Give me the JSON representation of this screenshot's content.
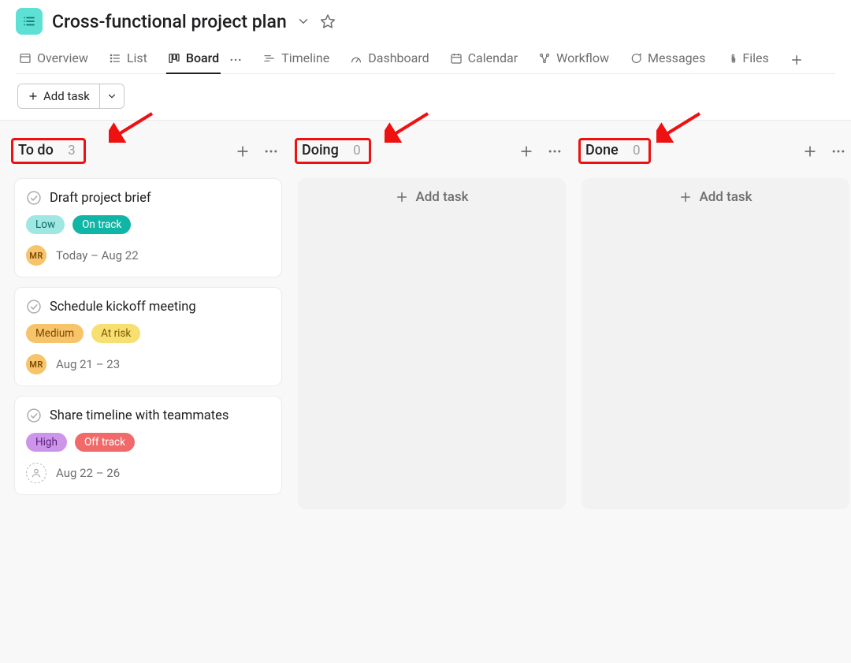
{
  "project": {
    "title": "Cross-functional project plan"
  },
  "tabs": {
    "overview": "Overview",
    "list": "List",
    "board": "Board",
    "timeline": "Timeline",
    "dashboard": "Dashboard",
    "calendar": "Calendar",
    "workflow": "Workflow",
    "messages": "Messages",
    "files": "Files"
  },
  "toolbar": {
    "add_task": "Add task"
  },
  "columns": [
    {
      "title": "To do",
      "count": "3",
      "add_label": "",
      "cards": [
        {
          "title": "Draft project brief",
          "tags": [
            {
              "label": "Low",
              "cls": "low"
            },
            {
              "label": "On track",
              "cls": "ontrack"
            }
          ],
          "avatar": "MR",
          "avatar_empty": false,
          "date": "Today – Aug 22"
        },
        {
          "title": "Schedule kickoff meeting",
          "tags": [
            {
              "label": "Medium",
              "cls": "medium"
            },
            {
              "label": "At risk",
              "cls": "atrisk"
            }
          ],
          "avatar": "MR",
          "avatar_empty": false,
          "date": "Aug 21 – 23"
        },
        {
          "title": "Share timeline with teammates",
          "tags": [
            {
              "label": "High",
              "cls": "high"
            },
            {
              "label": "Off track",
              "cls": "offtrack"
            }
          ],
          "avatar": "",
          "avatar_empty": true,
          "date": "Aug 22 – 26"
        }
      ]
    },
    {
      "title": "Doing",
      "count": "0",
      "add_label": "Add task",
      "cards": []
    },
    {
      "title": "Done",
      "count": "0",
      "add_label": "Add task",
      "cards": []
    }
  ]
}
